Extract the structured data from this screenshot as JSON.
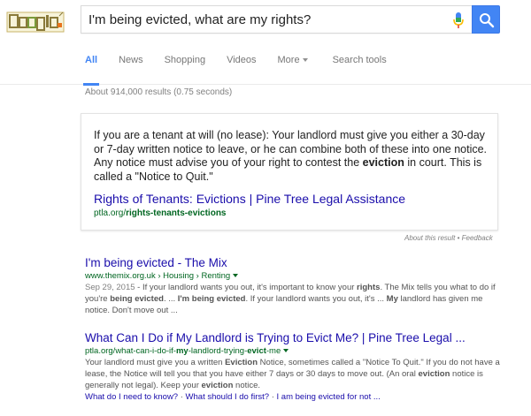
{
  "header": {
    "logo_text": "Google",
    "search_value": "I'm being evicted, what are my rights?",
    "colors": {
      "search_button": "#4285f4",
      "active_tab": "#4285f4",
      "link": "#1a0dab",
      "url": "#006621"
    }
  },
  "tabs": [
    {
      "label": "All"
    },
    {
      "label": "News"
    },
    {
      "label": "Shopping"
    },
    {
      "label": "Videos"
    },
    {
      "label": "More"
    },
    {
      "label": "Search tools"
    }
  ],
  "stats": "About 914,000 results (0.75 seconds)",
  "featured": {
    "text_1": "If you are a tenant at will (no lease): Your landlord must give you either a 30-day or 7-day written notice to leave, or he can combine both of these into one notice. Any notice must advise you of your right to contest the ",
    "text_bold": "eviction",
    "text_2": " in court. This is called a \"Notice to Quit.\"",
    "title": "Rights of Tenants: Evictions | Pine Tree Legal Assistance",
    "url_plain": "ptla.org/",
    "url_bold": "rights-tenants-evictions",
    "about": "About this result",
    "sep": " • ",
    "feedback": "Feedback"
  },
  "results": [
    {
      "title": "I'm being evicted - The Mix",
      "url": "www.themix.org.uk › Housing › Renting",
      "date": "Sep 29, 2015",
      "snippet": [
        {
          "t": " - If your landlord wants you out, it's important to know your "
        },
        {
          "b": "rights"
        },
        {
          "t": ". The Mix tells you what to do if you're "
        },
        {
          "b": "being evicted"
        },
        {
          "t": ". ... "
        },
        {
          "b": "I'm being evicted"
        },
        {
          "t": ". If your landlord wants you out, it's ... "
        },
        {
          "b": "My"
        },
        {
          "t": " landlord has given me notice. Don't move out ..."
        }
      ]
    },
    {
      "title": "What Can I Do if My Landlord is Trying to Evict Me? | Pine Tree Legal ...",
      "url_plain": "ptla.org/what-can-i-do-if-",
      "url_bold": "my",
      "url_plain2": "-landlord-trying-",
      "url_bold2": "evict",
      "url_plain3": "-me",
      "snippet": [
        {
          "t": "Your landlord must give you a written "
        },
        {
          "b": "Eviction"
        },
        {
          "t": " Notice, sometimes called a \"Notice To Quit.\" If you do not have a lease, the Notice will tell you that you have either 7 days or 30 days to move out. (An oral "
        },
        {
          "b": "eviction"
        },
        {
          "t": " notice is generally not legal). Keep your "
        },
        {
          "b": "eviction"
        },
        {
          "t": " notice."
        }
      ],
      "sitelinks": [
        "What do I need to know?",
        "What should I do first?",
        "I am being evicted for not ..."
      ],
      "sitelink_sep": " · "
    }
  ]
}
